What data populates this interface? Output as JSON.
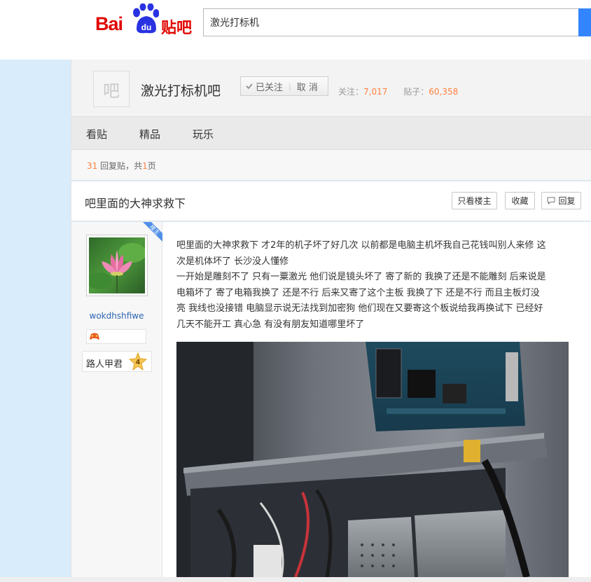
{
  "header": {
    "logo_text_latin": "Bai",
    "logo_text_du": "du",
    "logo_text_tieba": "贴吧",
    "search_value": "激光打标机"
  },
  "forum": {
    "avatar_char": "吧",
    "title": "激光打标机吧",
    "follow_label": "已关注",
    "cancel_label": "取 消",
    "followers_label": "关注：",
    "followers_count": "7,017",
    "posts_label": "贴子：",
    "posts_count": "60,358"
  },
  "nav": {
    "tabs": [
      "看贴",
      "精品",
      "玩乐"
    ]
  },
  "reply_info": {
    "count": "31",
    "text_mid": " 回复贴，共",
    "pages": "1",
    "text_end": "页"
  },
  "thread": {
    "title": "吧里面的大神求救下",
    "buttons": {
      "only_op": "只看楼主",
      "favorite": "收藏",
      "reply": "回复"
    }
  },
  "post": {
    "badge": "楼主",
    "username": "wokdhshfiwe",
    "level_name": "路人甲君",
    "level_num": "4",
    "lines": [
      "吧里面的大神求救下 才2年的机子坏了好几次 以前都是电脑主机坏我自己花钱叫别人来修 这",
      "次是机体坏了 长沙没人懂修",
      "一开始是雕刻不了 只有一粟激光 他们说是镜头坏了 寄了新的 我换了还是不能雕刻 后来说是",
      "电箱坏了 寄了电箱我换了 还是不行 后来又寄了这个主板 我换了下 还是不行 而且主板灯没",
      "亮 我线也没接错 电脑显示说无法找到加密狗 他们现在又要寄这个板说给我再换试下 已经好",
      "几天不能开工 真心急 有没有朋友知道哪里坏了"
    ]
  },
  "colors": {
    "accent_blue": "#3385ff",
    "baidu_red": "#e10601",
    "count_orange": "#ff7f3e",
    "link_blue": "#2d64b3",
    "page_bg": "#d9ecfb"
  }
}
